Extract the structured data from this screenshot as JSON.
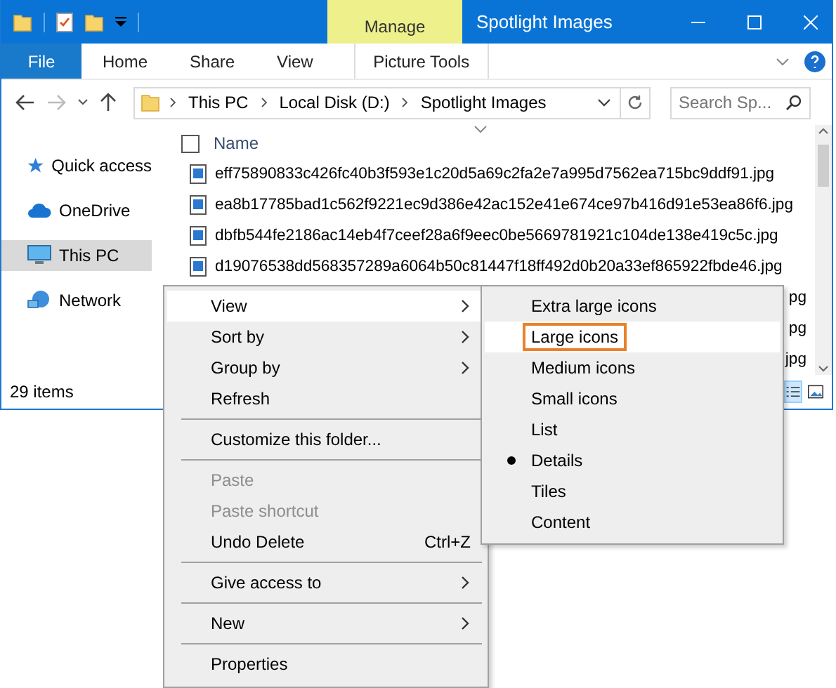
{
  "title_bar": {
    "context_group": "Manage",
    "title": "Spotlight Images"
  },
  "ribbon_tabs": [
    {
      "label": "File",
      "kind": "file",
      "selected": false
    },
    {
      "label": "Home",
      "kind": "tab",
      "selected": false
    },
    {
      "label": "Share",
      "kind": "tab",
      "selected": false
    },
    {
      "label": "View",
      "kind": "tab",
      "selected": false
    },
    {
      "label": "Picture Tools",
      "kind": "context",
      "selected": false
    }
  ],
  "address_bar": {
    "path": [
      "This PC",
      "Local Disk (D:)",
      "Spotlight Images"
    ]
  },
  "search": {
    "placeholder": "Search Sp..."
  },
  "sidebar": {
    "items": [
      {
        "label": "Quick access",
        "kind": "star",
        "selected": false
      },
      {
        "label": "OneDrive",
        "kind": "cloud",
        "selected": false
      },
      {
        "label": "This PC",
        "kind": "computer",
        "selected": true
      },
      {
        "label": "Network",
        "kind": "network",
        "selected": false
      }
    ]
  },
  "file_list": {
    "select_all": {
      "checked": false
    },
    "columns": [
      "Name"
    ],
    "rows": [
      {
        "name": "eff75890833c426fc40b3f593e1c20d5a69c2fa2e7a995d7562ea715bc9ddf91.jpg",
        "kind": "full"
      },
      {
        "name": "ea8b17785bad1c562f9221ec9d386e42ac152e41e674ce97b416d91e53ea86f6.jpg",
        "kind": "full"
      },
      {
        "name": "dbfb544fe2186ac14eb4f7ceef28a6f9eec0be5669781921c104de138e419c5c.jpg",
        "kind": "full"
      },
      {
        "name": "d19076538dd568357289a6064b50c81447f18ff492d0b20a33ef865922fbde46.jpg",
        "kind": "full"
      },
      {
        "name": "pg",
        "kind": "partial"
      },
      {
        "name": "pg",
        "kind": "partial"
      },
      {
        "name": "jpg",
        "kind": "partial"
      }
    ]
  },
  "status_bar": {
    "count": "29 items",
    "view_buttons": [
      {
        "kind": "details",
        "selected": true
      },
      {
        "kind": "large",
        "selected": false
      }
    ]
  },
  "context_menu": {
    "items": [
      {
        "kind": "item",
        "label": "View",
        "submenu": true,
        "hover": true,
        "disabled": false
      },
      {
        "kind": "item",
        "label": "Sort by",
        "submenu": true,
        "hover": false,
        "disabled": false
      },
      {
        "kind": "item",
        "label": "Group by",
        "submenu": true,
        "hover": false,
        "disabled": false
      },
      {
        "kind": "item",
        "label": "Refresh",
        "submenu": false,
        "hover": false,
        "disabled": false
      },
      {
        "kind": "separator"
      },
      {
        "kind": "item",
        "label": "Customize this folder...",
        "submenu": false,
        "hover": false,
        "disabled": false
      },
      {
        "kind": "separator"
      },
      {
        "kind": "item",
        "label": "Paste",
        "submenu": false,
        "hover": false,
        "disabled": true
      },
      {
        "kind": "item",
        "label": "Paste shortcut",
        "submenu": false,
        "hover": false,
        "disabled": true
      },
      {
        "kind": "item",
        "label": "Undo Delete",
        "shortcut": "Ctrl+Z",
        "submenu": false,
        "hover": false,
        "disabled": false
      },
      {
        "kind": "separator"
      },
      {
        "kind": "item",
        "label": "Give access to",
        "submenu": true,
        "hover": false,
        "disabled": false
      },
      {
        "kind": "separator"
      },
      {
        "kind": "item",
        "label": "New",
        "submenu": true,
        "hover": false,
        "disabled": false
      },
      {
        "kind": "separator"
      },
      {
        "kind": "item",
        "label": "Properties",
        "submenu": false,
        "hover": false,
        "disabled": false
      }
    ]
  },
  "view_submenu": {
    "items": [
      {
        "label": "Extra large icons",
        "hover": false,
        "selected": false,
        "highlighted": false
      },
      {
        "label": "Large icons",
        "hover": true,
        "selected": false,
        "highlighted": true
      },
      {
        "label": "Medium icons",
        "hover": false,
        "selected": false,
        "highlighted": false
      },
      {
        "label": "Small icons",
        "hover": false,
        "selected": false,
        "highlighted": false
      },
      {
        "label": "List",
        "hover": false,
        "selected": false,
        "highlighted": false
      },
      {
        "label": "Details",
        "hover": false,
        "selected": true,
        "highlighted": false
      },
      {
        "label": "Tiles",
        "hover": false,
        "selected": false,
        "highlighted": false
      },
      {
        "label": "Content",
        "hover": false,
        "selected": false,
        "highlighted": false
      }
    ]
  }
}
